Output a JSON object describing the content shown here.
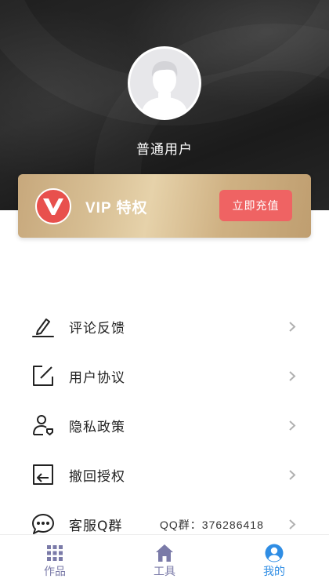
{
  "profile": {
    "username": "普通用户"
  },
  "vip": {
    "title": "VIP 特权",
    "recharge_label": "立即充值",
    "accent": "#ef6363"
  },
  "menu": [
    {
      "label": "评论反馈",
      "icon": "pen-icon"
    },
    {
      "label": "用户协议",
      "icon": "edit-document-icon"
    },
    {
      "label": "隐私政策",
      "icon": "user-shield-icon"
    },
    {
      "label": "撤回授权",
      "icon": "revoke-icon"
    },
    {
      "label": "客服Q群",
      "icon": "chat-bubble-icon",
      "extra": "QQ群：376286418"
    }
  ],
  "tabs": [
    {
      "label": "作品",
      "icon": "grid-icon",
      "active": false
    },
    {
      "label": "工具",
      "icon": "home-icon",
      "active": false
    },
    {
      "label": "我的",
      "icon": "user-circle-icon",
      "active": true
    }
  ],
  "colors": {
    "tab_inactive": "#7a7aa8",
    "tab_active": "#2f8de4"
  }
}
